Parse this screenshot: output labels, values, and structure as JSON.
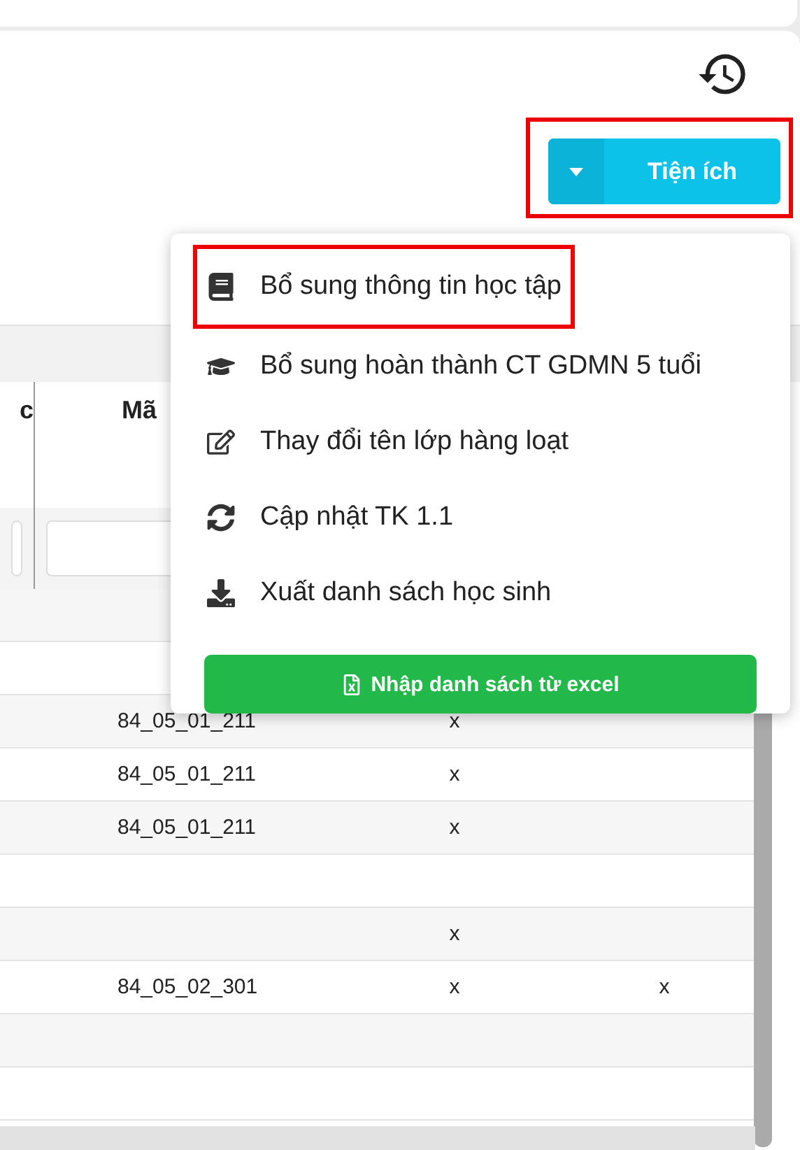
{
  "utility_button": {
    "label": "Tiện ích",
    "highlighted": true
  },
  "menu": {
    "items": [
      {
        "kind": "book",
        "label": "Bổ sung thông tin học tập",
        "highlighted": true
      },
      {
        "kind": "graduation",
        "label": "Bổ sung hoàn thành CT GDMN 5 tuổi",
        "highlighted": false
      },
      {
        "kind": "edit",
        "label": "Thay đổi tên lớp hàng loạt",
        "highlighted": false
      },
      {
        "kind": "sync",
        "label": "Cập nhật TK 1.1",
        "highlighted": false
      },
      {
        "kind": "download",
        "label": "Xuất danh sách học sinh",
        "highlighted": false
      }
    ],
    "import_button": {
      "label": "Nhập danh sách từ excel"
    }
  },
  "table": {
    "columns": [
      "c",
      "Mã"
    ],
    "rows": [
      [
        "",
        "",
        "",
        "",
        ""
      ],
      [
        "",
        "",
        "",
        "",
        ""
      ],
      [
        "",
        "84_05_01_211",
        "x",
        "",
        ""
      ],
      [
        "",
        "84_05_01_211",
        "x",
        "",
        ""
      ],
      [
        "",
        "84_05_01_211",
        "x",
        "",
        ""
      ],
      [
        "",
        "",
        "",
        "",
        ""
      ],
      [
        "",
        "",
        "x",
        "",
        ""
      ],
      [
        "",
        "84_05_02_301",
        "x",
        "x",
        ""
      ],
      [
        "",
        "",
        "",
        "",
        ""
      ],
      [
        "",
        "",
        "",
        "",
        ""
      ]
    ]
  }
}
